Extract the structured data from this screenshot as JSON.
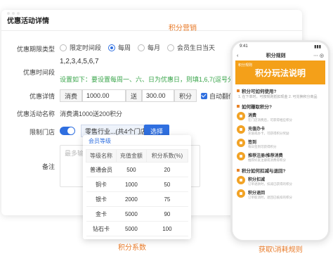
{
  "panel": {
    "title": "优惠活动详情",
    "caption": "积分营销"
  },
  "form": {
    "period_label": "优惠期限类型",
    "period_options": [
      "限定时间段",
      "每周",
      "每月",
      "会员生日当天"
    ],
    "period_selected": "每周",
    "time_label": "优惠时间段",
    "time_value": "1,2,3,4,5,6,7",
    "time_note": "设置如下：要设置每周一、六、日为优惠日，则填1,6,7(逗号分隔符必须是英文逗号)",
    "detail_label": "优惠详情",
    "consume_addon": "消费",
    "consume_value": "1000.00",
    "send_addon": "送",
    "send_value": "300.00",
    "points_addon": "积分",
    "auto_flip_label": "自动翻倍",
    "name_label": "优惠活动名称",
    "name_value": "消费满1000送200积分",
    "store_label": "限制门店",
    "store_value": "零售行业...(共4个门店)",
    "select_button": "选择",
    "remark_label": "备注",
    "remark_placeholder": "最多输入..."
  },
  "levels": {
    "tab": "会员等级",
    "caption": "积分系数",
    "headers": [
      "等级名称",
      "充值金额",
      "积分系数(%)"
    ],
    "rows": [
      [
        "普通会员",
        "500",
        "20"
      ],
      [
        "铜卡",
        "1000",
        "50"
      ],
      [
        "银卡",
        "2000",
        "75"
      ],
      [
        "金卡",
        "5000",
        "90"
      ],
      [
        "钻石卡",
        "5000",
        "100"
      ]
    ]
  },
  "phone": {
    "status_time": "9:41",
    "nav_title": "积分规则",
    "banner_small": "积分规则",
    "banner_title": "积分玩法说明",
    "sec1_title": "积分可如何使用?",
    "sec1_text": "1. 在下单时，可按规则抵扣现金 2. 可兑换积分商品",
    "sec2_title": "如何赚取积分?",
    "items": [
      {
        "name": "消费",
        "desc": "在门店消费后，可获得相应积分"
      },
      {
        "name": "充值办卡",
        "desc": "充值或办卡，可获得积分奖励"
      },
      {
        "name": "签到",
        "desc": "每日签到可获得积分"
      },
      {
        "name": "推荐注册/推荐消费",
        "desc": "推荐好友注册或消费得积分"
      }
    ],
    "sec3_title": "积分如何扣减与退回?",
    "items2": [
      {
        "name": "积分扣减",
        "desc": "订单退款时，扣减已获得的积分"
      },
      {
        "name": "积分退回",
        "desc": "订单取消时，退回已抵扣的积分"
      }
    ],
    "caption": "获取\\消耗规则"
  },
  "colors": {
    "accent_blue": "#2f6fe0",
    "orange": "#e87b2a",
    "green_note": "#3aa54b",
    "banner": "#f4a019"
  }
}
